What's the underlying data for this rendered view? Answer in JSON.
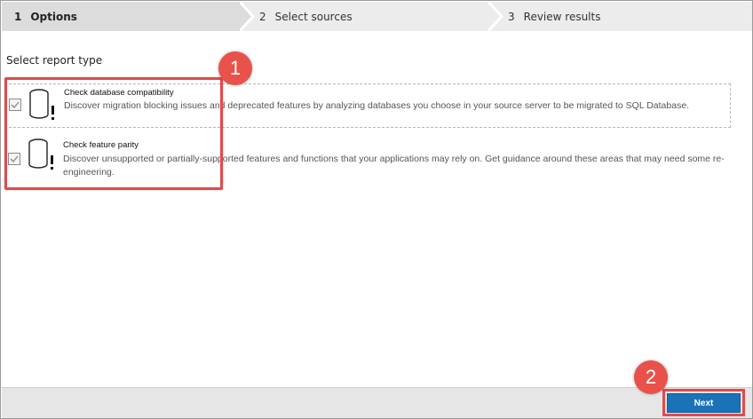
{
  "wizard": {
    "steps": [
      {
        "number": "1",
        "label": "Options"
      },
      {
        "number": "2",
        "label": "Select sources"
      },
      {
        "number": "3",
        "label": "Review results"
      }
    ]
  },
  "main": {
    "section_title": "Select report type",
    "options": [
      {
        "title": "Check database compatibility",
        "description": "Discover migration blocking issues and deprecated features by analyzing databases you choose in your source server to be migrated to SQL Database.",
        "checked": true,
        "icon": "database-warning-icon"
      },
      {
        "title": "Check feature parity",
        "description": "Discover unsupported or partially-supported features and functions that your applications may rely on. Get guidance around these areas that may need some re-engineering.",
        "checked": true,
        "icon": "database-warning-icon"
      }
    ]
  },
  "callouts": {
    "first": "1",
    "second": "2"
  },
  "footer": {
    "next_label": "Next"
  },
  "colors": {
    "accent": "#1a73b8",
    "highlight": "#e04b4b",
    "callout": "#e8524a"
  }
}
